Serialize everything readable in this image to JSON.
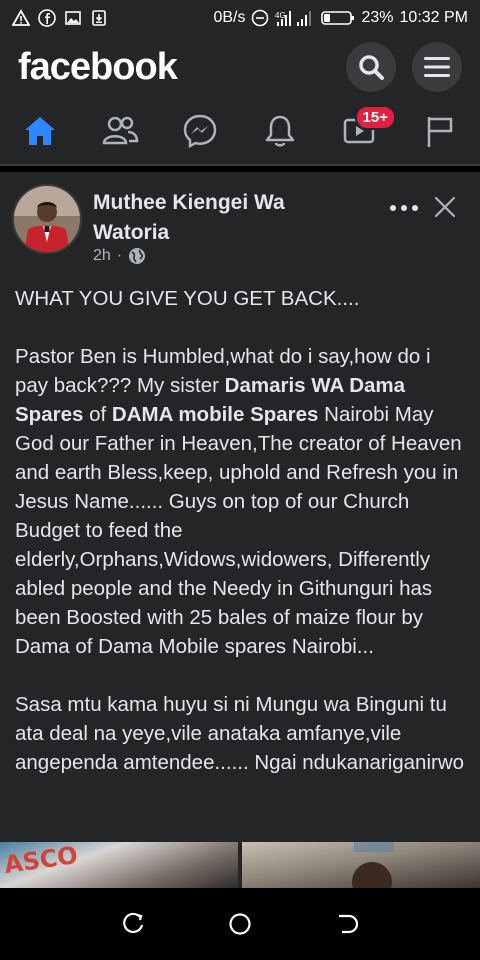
{
  "status_bar": {
    "speed": "0B/s",
    "battery": "23%",
    "time": "10:32 PM"
  },
  "header": {
    "logo": "facebook",
    "search_icon": "search-icon",
    "menu_icon": "menu-icon"
  },
  "nav": {
    "items": [
      {
        "name": "home",
        "icon": "home-icon",
        "active": true
      },
      {
        "name": "friends",
        "icon": "friends-icon"
      },
      {
        "name": "messenger",
        "icon": "messenger-icon"
      },
      {
        "name": "notifications",
        "icon": "bell-icon"
      },
      {
        "name": "watch",
        "icon": "video-icon",
        "badge": "15+"
      },
      {
        "name": "pages",
        "icon": "flag-icon"
      }
    ]
  },
  "post": {
    "author": "Muthee Kiengei Wa Watoria",
    "time": "2h",
    "separator": "·",
    "paragraph1": "WHAT YOU GIVE YOU GET BACK....",
    "p2_part1": "Pastor Ben is Humbled,what do i say,how do i pay back??? My sister ",
    "p2_bold1": "Damaris WA Dama Spares",
    "p2_part2": " of ",
    "p2_bold2": "DAMA mobile Spares",
    "p2_part3": " Nairobi May God our Father in Heaven,The creator of Heaven and earth Bless,keep, uphold and Refresh you in Jesus Name...... Guys on top of our Church Budget to feed the elderly,Orphans,Widows,widowers, Differently abled people and the Needy in Githunguri has been Boosted with 25 bales of maize flour by Dama of Dama Mobile spares Nairobi...",
    "paragraph3": "Sasa mtu kama huyu si ni Mungu wa Binguni tu ata deal na yeye,vile anataka amfanye,vile angependa amtendee...... Ngai ndukanariganirwo",
    "photo1_text": "ASCO"
  },
  "colors": {
    "accent": "#2d88ff",
    "surface": "#242526",
    "badge": "#e41e3f"
  }
}
